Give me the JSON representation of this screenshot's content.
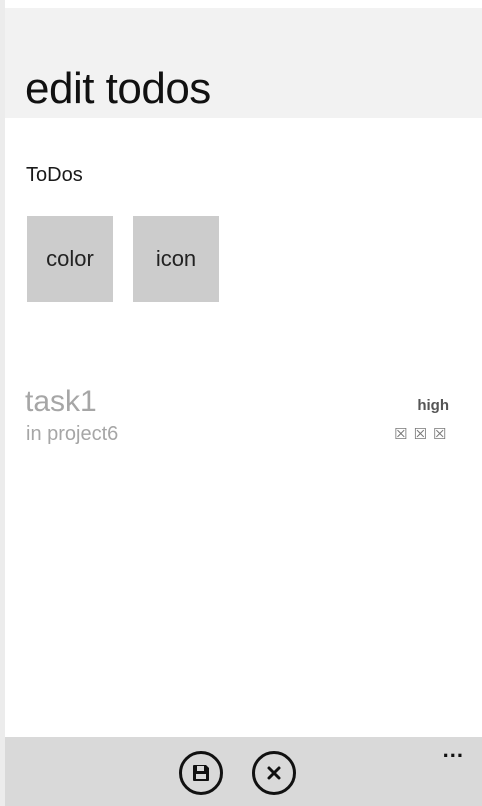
{
  "header": {
    "title": "edit todos"
  },
  "section": {
    "label": "ToDos"
  },
  "buttons": {
    "color_label": "color",
    "icon_label": "icon"
  },
  "task": {
    "title": "task1",
    "project": "in project6",
    "priority": "high",
    "priority_icons": [
      "☒",
      "☒",
      "☒"
    ]
  },
  "app_bar": {
    "save_icon": "save-icon",
    "cancel_icon": "close-icon",
    "more_label": "..."
  },
  "colors": {
    "accent": "#d80073",
    "header_bg": "#f2f2f2",
    "tile_bg": "#cccccc",
    "app_bar_bg": "#d9d9d9",
    "task_text": "#a6a6a6"
  }
}
